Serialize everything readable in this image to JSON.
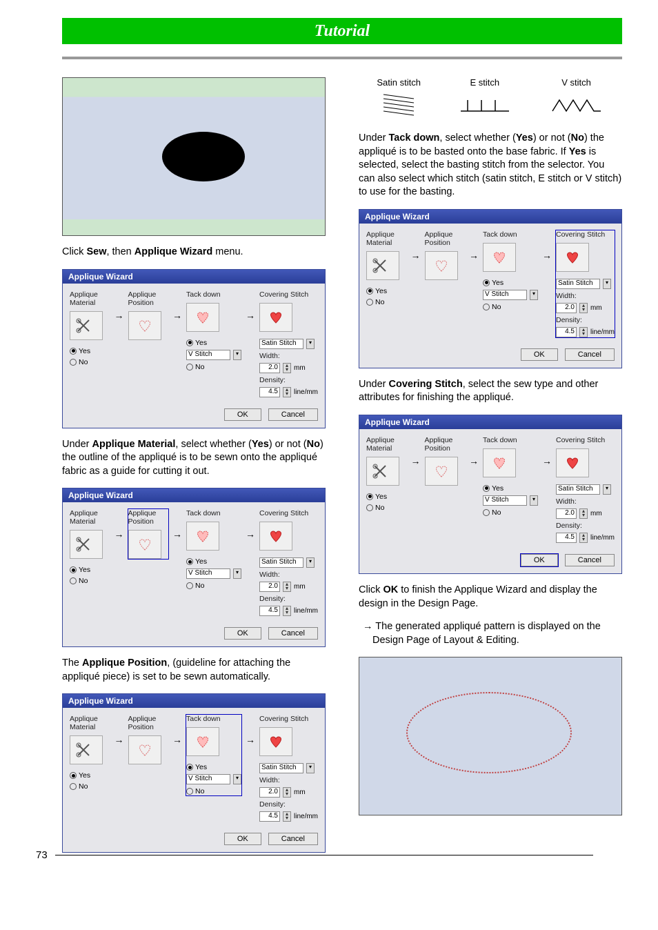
{
  "header": {
    "title": "Tutorial"
  },
  "page_number": "73",
  "stitches": {
    "satin": "Satin stitch",
    "e": "E stitch",
    "v": "V stitch"
  },
  "wizard": {
    "title": "Applique Wizard",
    "col_material": "Applique Material",
    "col_position": "Applique Position",
    "col_tack": "Tack down",
    "col_covering": "Covering Stitch",
    "opt_yes": "Yes",
    "opt_no": "No",
    "stitch_select": "V Stitch",
    "cov_select": "Satin Stitch",
    "width_label": "Width:",
    "width_val": "2.0",
    "width_unit": "mm",
    "density_label": "Density:",
    "density_val": "4.5",
    "density_unit": "line/mm",
    "ok": "OK",
    "cancel": "Cancel"
  },
  "left": {
    "p1_a": "Click ",
    "p1_b": "Sew",
    "p1_c": ", then ",
    "p1_d": "Applique Wizard",
    "p1_e": " menu.",
    "p2_a": "Under ",
    "p2_b": "Applique Material",
    "p2_c": ", select whether (",
    "p2_d": "Yes",
    "p2_e": ") or not (",
    "p2_f": "No",
    "p2_g": ") the outline of the appliqué is to be sewn onto the appliqué fabric as a guide for cutting it out.",
    "p3_a": "The ",
    "p3_b": "Applique Position",
    "p3_c": ", (guideline for attaching the appliqué piece) is set to be sewn automatically."
  },
  "right": {
    "p1_a": "Under ",
    "p1_b": "Tack down",
    "p1_c": ", select whether (",
    "p1_d": "Yes",
    "p1_e": ") or not (",
    "p1_f": "No",
    "p1_g": ") the appliqué is to be basted onto the base fabric. If ",
    "p1_h": "Yes",
    "p1_i": " is selected, select the basting stitch from the selector. You can also select which stitch (satin stitch, E stitch or V stitch) to use for the basting.",
    "p2_a": "Under ",
    "p2_b": "Covering Stitch",
    "p2_c": ", select the sew type and other attributes for finishing the appliqué.",
    "p3_a": "Click ",
    "p3_b": "OK",
    "p3_c": " to finish the Applique Wizard and display the design in the Design Page.",
    "bullet_arrow": "→",
    "bullet": "The generated appliqué pattern is displayed on the Design Page of Layout & Editing."
  }
}
